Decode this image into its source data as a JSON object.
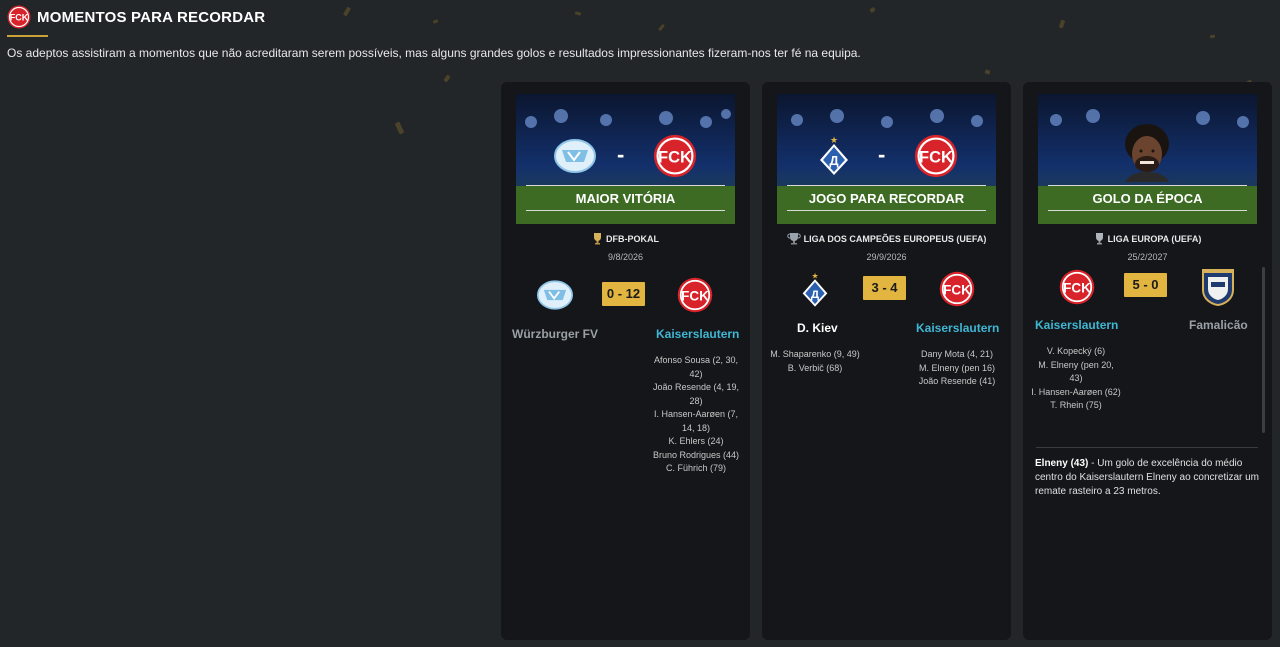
{
  "header": {
    "title": "MOMENTOS PARA RECORDAR",
    "subtitle": "Os adeptos assistiram a momentos que não acreditaram serem possíveis, mas alguns grandes golos e resultados impressionantes fizeram-nos ter fé na equipa."
  },
  "colors": {
    "background": "#232629",
    "card": "#141619",
    "score_box": "#e2b540",
    "our_team": "#3fb6d3",
    "accent_underline": "#c9a23a",
    "club_red": "#d8232a"
  },
  "cards": [
    {
      "banner_title": "MAIOR VITÓRIA",
      "competition": "DFB-POKAL",
      "date": "9/8/2026",
      "score": "0 - 12",
      "home_team": "Würzburger FV",
      "away_team": "Kaiserslautern",
      "home_scorers": [],
      "away_scorers": [
        "Afonso Sousa (2, 30, 42)",
        "João Resende (4, 19, 28)",
        "I. Hansen-Aarøen (7, 14, 18)",
        "K. Ehlers (24)",
        "Bruno Rodrigues (44)",
        "C. Führich (79)"
      ]
    },
    {
      "banner_title": "JOGO PARA RECORDAR",
      "competition": "LIGA DOS CAMPEÕES EUROPEUS (UEFA)",
      "date": "29/9/2026",
      "score": "3 - 4",
      "home_team": "D. Kiev",
      "away_team": "Kaiserslautern",
      "home_scorers": [
        "M. Shaparenko (9, 49)",
        "B. Verbič (68)"
      ],
      "away_scorers": [
        "Dany Mota (4, 21)",
        "M. Elneny (pen 16)",
        "João Resende (41)"
      ]
    },
    {
      "banner_title": "GOLO DA ÉPOCA",
      "competition": "LIGA EUROPA (UEFA)",
      "date": "25/2/2027",
      "score": "5 - 0",
      "home_team": "Kaiserslautern",
      "away_team": "Famalicão",
      "home_scorers": [
        "V. Kopecký (6)",
        "M. Elneny (pen 20, 43)",
        "I. Hansen-Aarøen (62)",
        "T. Rhein (75)"
      ],
      "away_scorers": [],
      "goal_scorer": "Elneny (43)",
      "goal_description": " - Um golo de excelência do médio centro do Kaiserslautern Elneny ao concretizar um remate rasteiro a 23 metros."
    }
  ],
  "icons": {
    "club_logo": "fck-crest-icon",
    "trophy": "trophy-icon",
    "wurzburg": "wurzburger-fv-crest-icon",
    "kiev": "dynamo-kiev-crest-icon",
    "famalicao": "famalicao-crest-icon",
    "player": "player-photo"
  }
}
